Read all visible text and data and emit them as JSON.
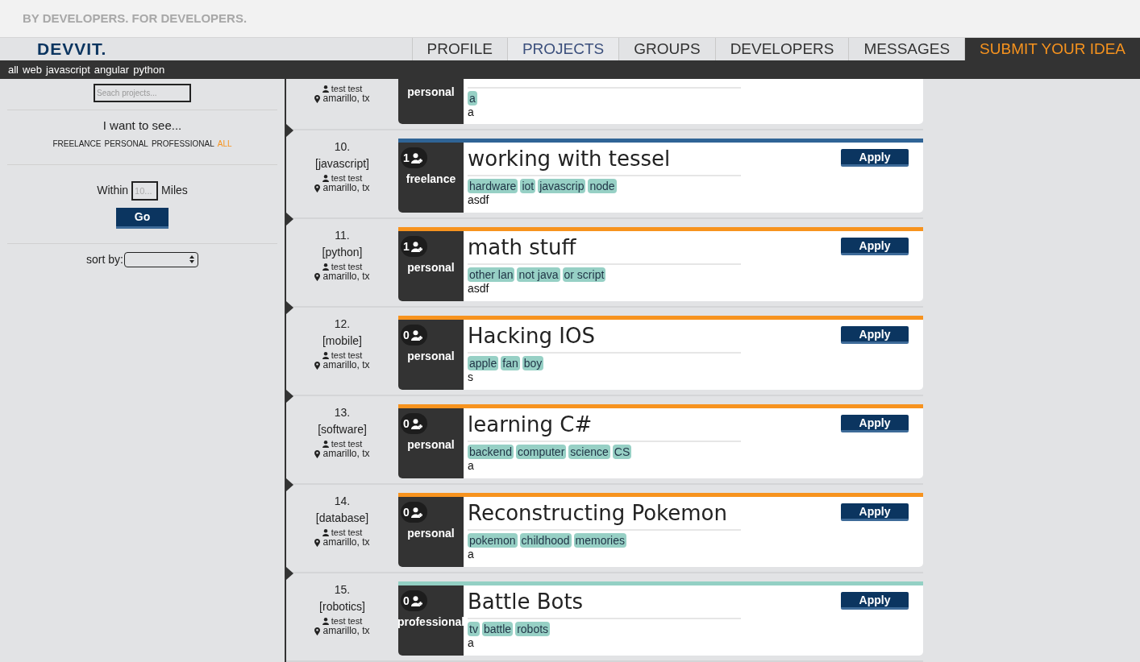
{
  "tagline": "BY DEVELOPERS. FOR DEVELOPERS.",
  "logo": "DEVVIT.",
  "nav": [
    {
      "label": "PROFILE",
      "selected": false,
      "kind": "tab"
    },
    {
      "label": "PROJECTS",
      "selected": true,
      "kind": "tab"
    },
    {
      "label": "GROUPS",
      "selected": false,
      "kind": "tab"
    },
    {
      "label": "DEVELOPERS",
      "selected": false,
      "kind": "tab"
    },
    {
      "label": "MESSAGES",
      "selected": false,
      "kind": "tab"
    },
    {
      "label": "SUBMIT YOUR IDEA",
      "selected": false,
      "kind": "cta"
    }
  ],
  "categories": [
    "all",
    "web",
    "javascript",
    "angular",
    "python"
  ],
  "sidebar": {
    "search": {
      "placeholder": "Seach projects..."
    },
    "filter_heading": "I want to see...",
    "filters": [
      {
        "label": "FREELANCE",
        "selected": false
      },
      {
        "label": "PERSONAL",
        "selected": false
      },
      {
        "label": "PROFESSIONAL",
        "selected": false
      },
      {
        "label": "ALL",
        "selected": true
      }
    ],
    "within_label": "Within",
    "miles": {
      "placeholder": "10..."
    },
    "miles_label": "Miles",
    "go": "Go",
    "sort_label": "sort by:"
  },
  "projects": [
    {
      "user": "test test",
      "location": "amarillo, tx",
      "type": "personal",
      "tags": [
        "a"
      ],
      "description": "a"
    },
    {
      "number": "10.",
      "category": "[javascript]",
      "user": "test test",
      "location": "amarillo, tx",
      "count": "1",
      "type": "freelance",
      "color": "#2f6496",
      "title": "working with tessel",
      "tags": [
        "hardware",
        "iot",
        "javascrip",
        "node"
      ],
      "description": "asdf",
      "apply": "Apply"
    },
    {
      "number": "11.",
      "category": "[python]",
      "user": "test test",
      "location": "amarillo, tx",
      "count": "1",
      "type": "personal",
      "color": "#f7931e",
      "title": "math stuff",
      "tags": [
        "other lan",
        "not java",
        "or script"
      ],
      "description": "asdf",
      "apply": "Apply"
    },
    {
      "number": "12.",
      "category": "[mobile]",
      "user": "test test",
      "location": "amarillo, tx",
      "count": "0",
      "type": "personal",
      "color": "#f7931e",
      "title": "Hacking IOS",
      "tags": [
        "apple",
        "fan",
        "boy"
      ],
      "description": "s",
      "apply": "Apply"
    },
    {
      "number": "13.",
      "category": "[software]",
      "user": "test test",
      "location": "amarillo, tx",
      "count": "0",
      "type": "personal",
      "color": "#f7931e",
      "title": "learning C#",
      "tags": [
        "backend",
        "computer",
        "science",
        "CS"
      ],
      "description": "a",
      "apply": "Apply"
    },
    {
      "number": "14.",
      "category": "[database]",
      "user": "test test",
      "location": "amarillo, tx",
      "count": "0",
      "type": "personal",
      "color": "#f7931e",
      "title": "Reconstructing Pokemon",
      "tags": [
        "pokemon",
        "childhood",
        "memories"
      ],
      "description": "a",
      "apply": "Apply"
    },
    {
      "number": "15.",
      "category": "[robotics]",
      "user": "test test",
      "location": "amarillo, tx",
      "count": "0",
      "type": "professional",
      "color": "#93d0c4",
      "title": "Battle Bots",
      "tags": [
        "tv",
        "battle",
        "robots"
      ],
      "description": "a",
      "apply": "Apply"
    }
  ]
}
